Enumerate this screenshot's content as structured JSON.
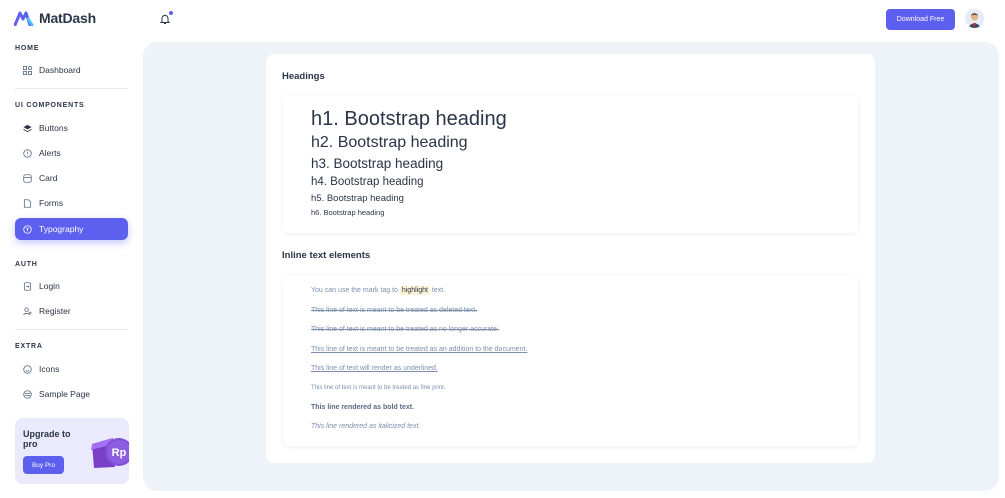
{
  "brand": {
    "name": "MatDash"
  },
  "sidebar": {
    "sections": [
      {
        "title": "HOME",
        "items": [
          {
            "label": "Dashboard",
            "icon": "dashboard-icon"
          }
        ]
      },
      {
        "title": "UI COMPONENTS",
        "items": [
          {
            "label": "Buttons",
            "icon": "layers-icon"
          },
          {
            "label": "Alerts",
            "icon": "alert-circle-icon"
          },
          {
            "label": "Card",
            "icon": "card-icon"
          },
          {
            "label": "Forms",
            "icon": "file-icon"
          },
          {
            "label": "Typography",
            "icon": "typography-icon",
            "active": true
          }
        ]
      },
      {
        "title": "AUTH",
        "items": [
          {
            "label": "Login",
            "icon": "login-icon"
          },
          {
            "label": "Register",
            "icon": "user-plus-icon"
          }
        ]
      },
      {
        "title": "EXTRA",
        "items": [
          {
            "label": "Icons",
            "icon": "mood-icon"
          },
          {
            "label": "Sample Page",
            "icon": "aperture-icon"
          }
        ]
      }
    ],
    "upgrade": {
      "title": "Upgrade to pro",
      "button": "Buy Pro",
      "badge": "Rp"
    }
  },
  "topbar": {
    "download_label": "Download Free"
  },
  "content": {
    "headings_title": "Headings",
    "headings": [
      "h1. Bootstrap heading",
      "h2. Bootstrap heading",
      "h3. Bootstrap heading",
      "h4. Bootstrap heading",
      "h5. Bootstrap heading",
      "h6. Bootstrap heading"
    ],
    "inline_title": "Inline text elements",
    "inline": {
      "mark_before": "You can use the mark tag to ",
      "mark_word": "highlight",
      "mark_after": " text.",
      "deleted": "This line of text is meant to be treated as deleted text.",
      "strikethrough": "This line of text is meant to be treated as no longer accurate.",
      "inserted": "This line of text is meant to be treated as an addition to the document.",
      "underlined": "This line of text will render as underlined.",
      "small": "This line of text is meant to be treated as fine print.",
      "bold": "This line rendered as bold text.",
      "italic": "This line rendered as italicized text."
    }
  },
  "colors": {
    "primary": "#5d5fef",
    "text": "#2a3547",
    "muted": "#7c8fac",
    "page_bg": "#eef3f9",
    "mark_bg": "#fdf3d6"
  }
}
